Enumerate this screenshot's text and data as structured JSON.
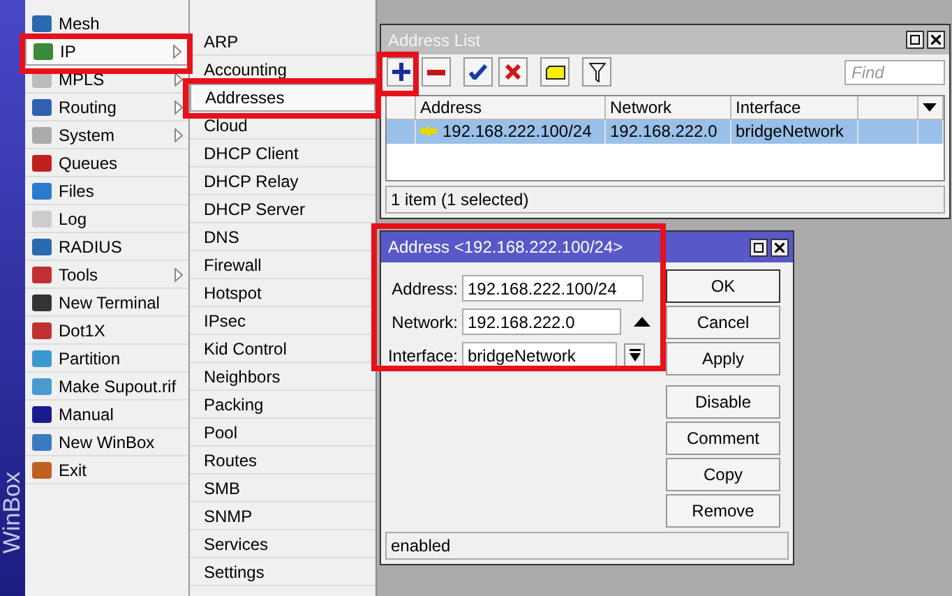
{
  "sidebar": {
    "brand": "WinBox",
    "items": [
      {
        "label": "Mesh",
        "submenu": false,
        "selected": false
      },
      {
        "label": "IP",
        "submenu": true,
        "selected": true
      },
      {
        "label": "MPLS",
        "submenu": true,
        "selected": false
      },
      {
        "label": "Routing",
        "submenu": true,
        "selected": false
      },
      {
        "label": "System",
        "submenu": true,
        "selected": false
      },
      {
        "label": "Queues",
        "submenu": false,
        "selected": false
      },
      {
        "label": "Files",
        "submenu": false,
        "selected": false
      },
      {
        "label": "Log",
        "submenu": false,
        "selected": false
      },
      {
        "label": "RADIUS",
        "submenu": false,
        "selected": false
      },
      {
        "label": "Tools",
        "submenu": true,
        "selected": false
      },
      {
        "label": "New Terminal",
        "submenu": false,
        "selected": false
      },
      {
        "label": "Dot1X",
        "submenu": false,
        "selected": false
      },
      {
        "label": "Partition",
        "submenu": false,
        "selected": false
      },
      {
        "label": "Make Supout.rif",
        "submenu": false,
        "selected": false
      },
      {
        "label": "Manual",
        "submenu": false,
        "selected": false
      },
      {
        "label": "New WinBox",
        "submenu": false,
        "selected": false
      },
      {
        "label": "Exit",
        "submenu": false,
        "selected": false
      }
    ]
  },
  "submenu": {
    "items": [
      {
        "label": "ARP",
        "selected": false
      },
      {
        "label": "Accounting",
        "selected": false
      },
      {
        "label": "Addresses",
        "selected": true
      },
      {
        "label": "Cloud",
        "selected": false
      },
      {
        "label": "DHCP Client",
        "selected": false
      },
      {
        "label": "DHCP Relay",
        "selected": false
      },
      {
        "label": "DHCP Server",
        "selected": false
      },
      {
        "label": "DNS",
        "selected": false
      },
      {
        "label": "Firewall",
        "selected": false
      },
      {
        "label": "Hotspot",
        "selected": false
      },
      {
        "label": "IPsec",
        "selected": false
      },
      {
        "label": "Kid Control",
        "selected": false
      },
      {
        "label": "Neighbors",
        "selected": false
      },
      {
        "label": "Packing",
        "selected": false
      },
      {
        "label": "Pool",
        "selected": false
      },
      {
        "label": "Routes",
        "selected": false
      },
      {
        "label": "SMB",
        "selected": false
      },
      {
        "label": "SNMP",
        "selected": false
      },
      {
        "label": "Services",
        "selected": false
      },
      {
        "label": "Settings",
        "selected": false
      }
    ]
  },
  "address_list": {
    "title": "Address List",
    "toolbar": [
      {
        "kind": "add"
      },
      {
        "kind": "remove"
      },
      {
        "kind": "enable"
      },
      {
        "kind": "disable"
      },
      {
        "kind": "comment"
      },
      {
        "kind": "filter"
      }
    ],
    "find": {
      "placeholder": "Find"
    },
    "columns": [
      "Address",
      "Network",
      "Interface"
    ],
    "rows": [
      {
        "address": "192.168.222.100/24",
        "network": "192.168.222.0",
        "interface": "bridgeNetwork",
        "selected": true
      }
    ],
    "status": "1 item (1 selected)"
  },
  "address_dialog": {
    "title": "Address <192.168.222.100/24>",
    "fields": [
      {
        "label": "Address:",
        "value": "192.168.222.100/24",
        "kind": "text"
      },
      {
        "label": "Network:",
        "value": "192.168.222.0",
        "kind": "collapse"
      },
      {
        "label": "Interface:",
        "value": "bridgeNetwork",
        "kind": "dropdown"
      }
    ],
    "buttons": [
      "OK",
      "Cancel",
      "Apply",
      "Disable",
      "Comment",
      "Copy",
      "Remove"
    ],
    "status": "enabled"
  }
}
